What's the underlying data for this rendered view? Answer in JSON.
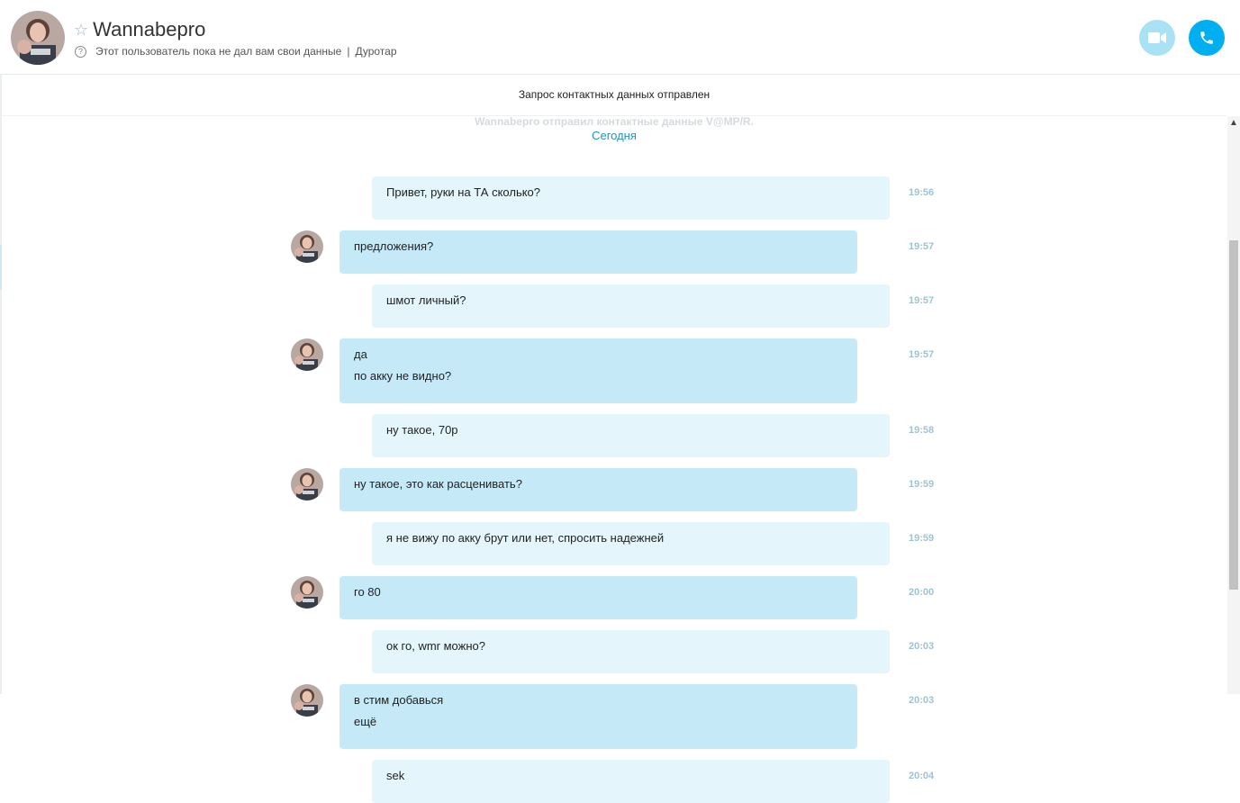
{
  "header": {
    "contact_name": "Wannabepro",
    "status_text": "Этот пользователь пока не дал вам свои данные",
    "separator": "|",
    "location": "Дуротар",
    "star_icon": "star-outline-icon",
    "help_icon": "question-circle-icon",
    "video_call_icon": "video-camera-icon",
    "voice_call_icon": "phone-icon",
    "video_button_color": "#a9e1f5",
    "voice_button_color": "#00aff0"
  },
  "banner": {
    "text": "Запрос контактных данных отправлен"
  },
  "faded_note": "Wannabepro отправил контактные данные V@MP/R.",
  "date_separator": "Сегодня",
  "colors": {
    "outgoing_bubble": "#e4f5fc",
    "incoming_bubble": "#c6e9f8",
    "time": "#9fc3d2",
    "accent": "#00aff0"
  },
  "messages": [
    {
      "direction": "out",
      "lines": [
        "Привет, руки на ТА сколько?"
      ],
      "time": "19:56"
    },
    {
      "direction": "in",
      "lines": [
        "предложения?"
      ],
      "time": "19:57"
    },
    {
      "direction": "out",
      "lines": [
        "шмот личный?"
      ],
      "time": "19:57"
    },
    {
      "direction": "in",
      "lines": [
        "да",
        "по акку не видно?"
      ],
      "time": "19:57"
    },
    {
      "direction": "out",
      "lines": [
        "ну такое, 70р"
      ],
      "time": "19:58"
    },
    {
      "direction": "in",
      "lines": [
        "ну такое, это как расценивать?"
      ],
      "time": "19:59"
    },
    {
      "direction": "out",
      "lines": [
        "я не вижу по акку брут или нет, спросить надежней"
      ],
      "time": "19:59"
    },
    {
      "direction": "in",
      "lines": [
        "го 80"
      ],
      "time": "20:00"
    },
    {
      "direction": "out",
      "lines": [
        "ок го, wmr можно?"
      ],
      "time": "20:03"
    },
    {
      "direction": "in",
      "lines": [
        "в стим добавься",
        "ещё"
      ],
      "time": "20:03"
    },
    {
      "direction": "out",
      "lines": [
        "sek"
      ],
      "time": "20:04"
    }
  ]
}
